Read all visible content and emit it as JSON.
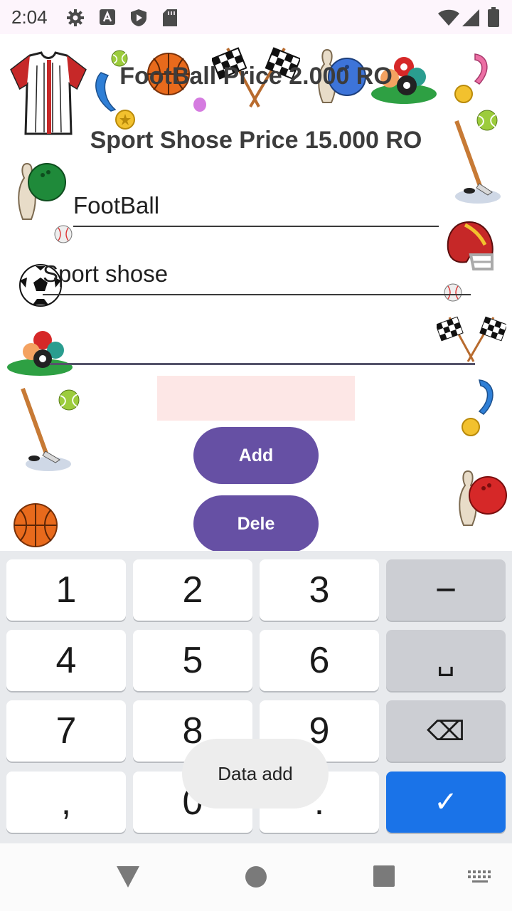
{
  "status_bar": {
    "time": "2:04",
    "icons": [
      "settings-gear-icon",
      "text-a-icon",
      "shield-play-icon",
      "sd-card-icon",
      "wifi-icon",
      "cell-signal-icon",
      "battery-icon"
    ]
  },
  "app": {
    "price_line_1": "FootBall Price 2.000 RO",
    "price_line_2": "Sport Shose Price 15.000 RO",
    "field_product_1": "FootBall",
    "field_product_2": "Sport shose",
    "field_quantity": "",
    "add_button": "Add",
    "delete_button": "Dele"
  },
  "keyboard": {
    "keys": [
      "1",
      "2",
      "3",
      "−",
      "4",
      "5",
      "6",
      "␣",
      "7",
      "8",
      "9",
      "⌫",
      ",",
      "0",
      ".",
      "✓"
    ]
  },
  "toast": {
    "message": "Data add"
  },
  "nav": {
    "icons": [
      "back-triangle-icon",
      "home-circle-icon",
      "recents-square-icon",
      "keyboard-switch-icon"
    ]
  },
  "colors": {
    "accent_purple": "#6650a4",
    "enter_blue": "#1a73e8",
    "status_bg": "#fdf5fc",
    "error_pink": "#fde7e6"
  }
}
